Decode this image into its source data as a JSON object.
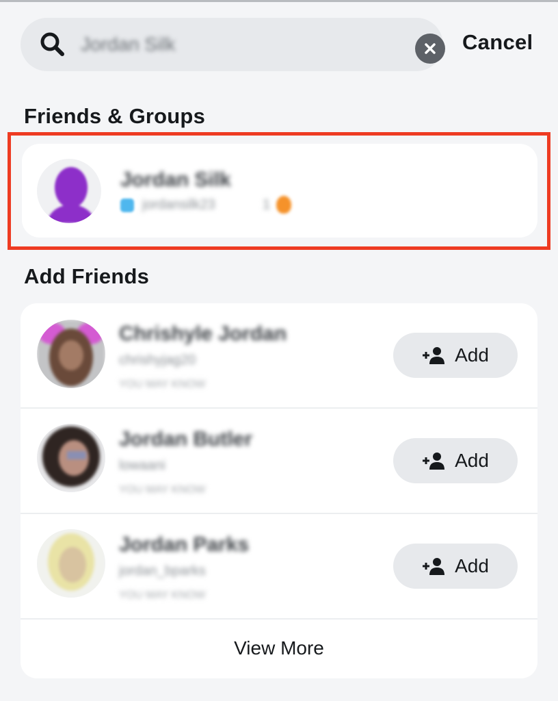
{
  "search": {
    "query": "Jordan Silk",
    "cancel_label": "Cancel"
  },
  "sections": {
    "friends_groups_title": "Friends & Groups",
    "add_friends_title": "Add Friends"
  },
  "friend_result": {
    "name": "Jordan Silk",
    "username": "jordansilk23",
    "streak": "1"
  },
  "add_friends": [
    {
      "name": "Chrishyle Jordan",
      "username": "chrishyjag20",
      "meta": "YOU MAY KNOW",
      "add_label": "Add"
    },
    {
      "name": "Jordan Butler",
      "username": "lowaani",
      "meta": "YOU MAY KNOW",
      "add_label": "Add"
    },
    {
      "name": "Jordan Parks",
      "username": "jordan_bparks",
      "meta": "YOU MAY KNOW",
      "add_label": "Add"
    }
  ],
  "view_more_label": "View More",
  "colors": {
    "highlight": "#ee3b22",
    "bitmoji_purple": "#8d2fc9",
    "background": "#f4f5f7"
  }
}
